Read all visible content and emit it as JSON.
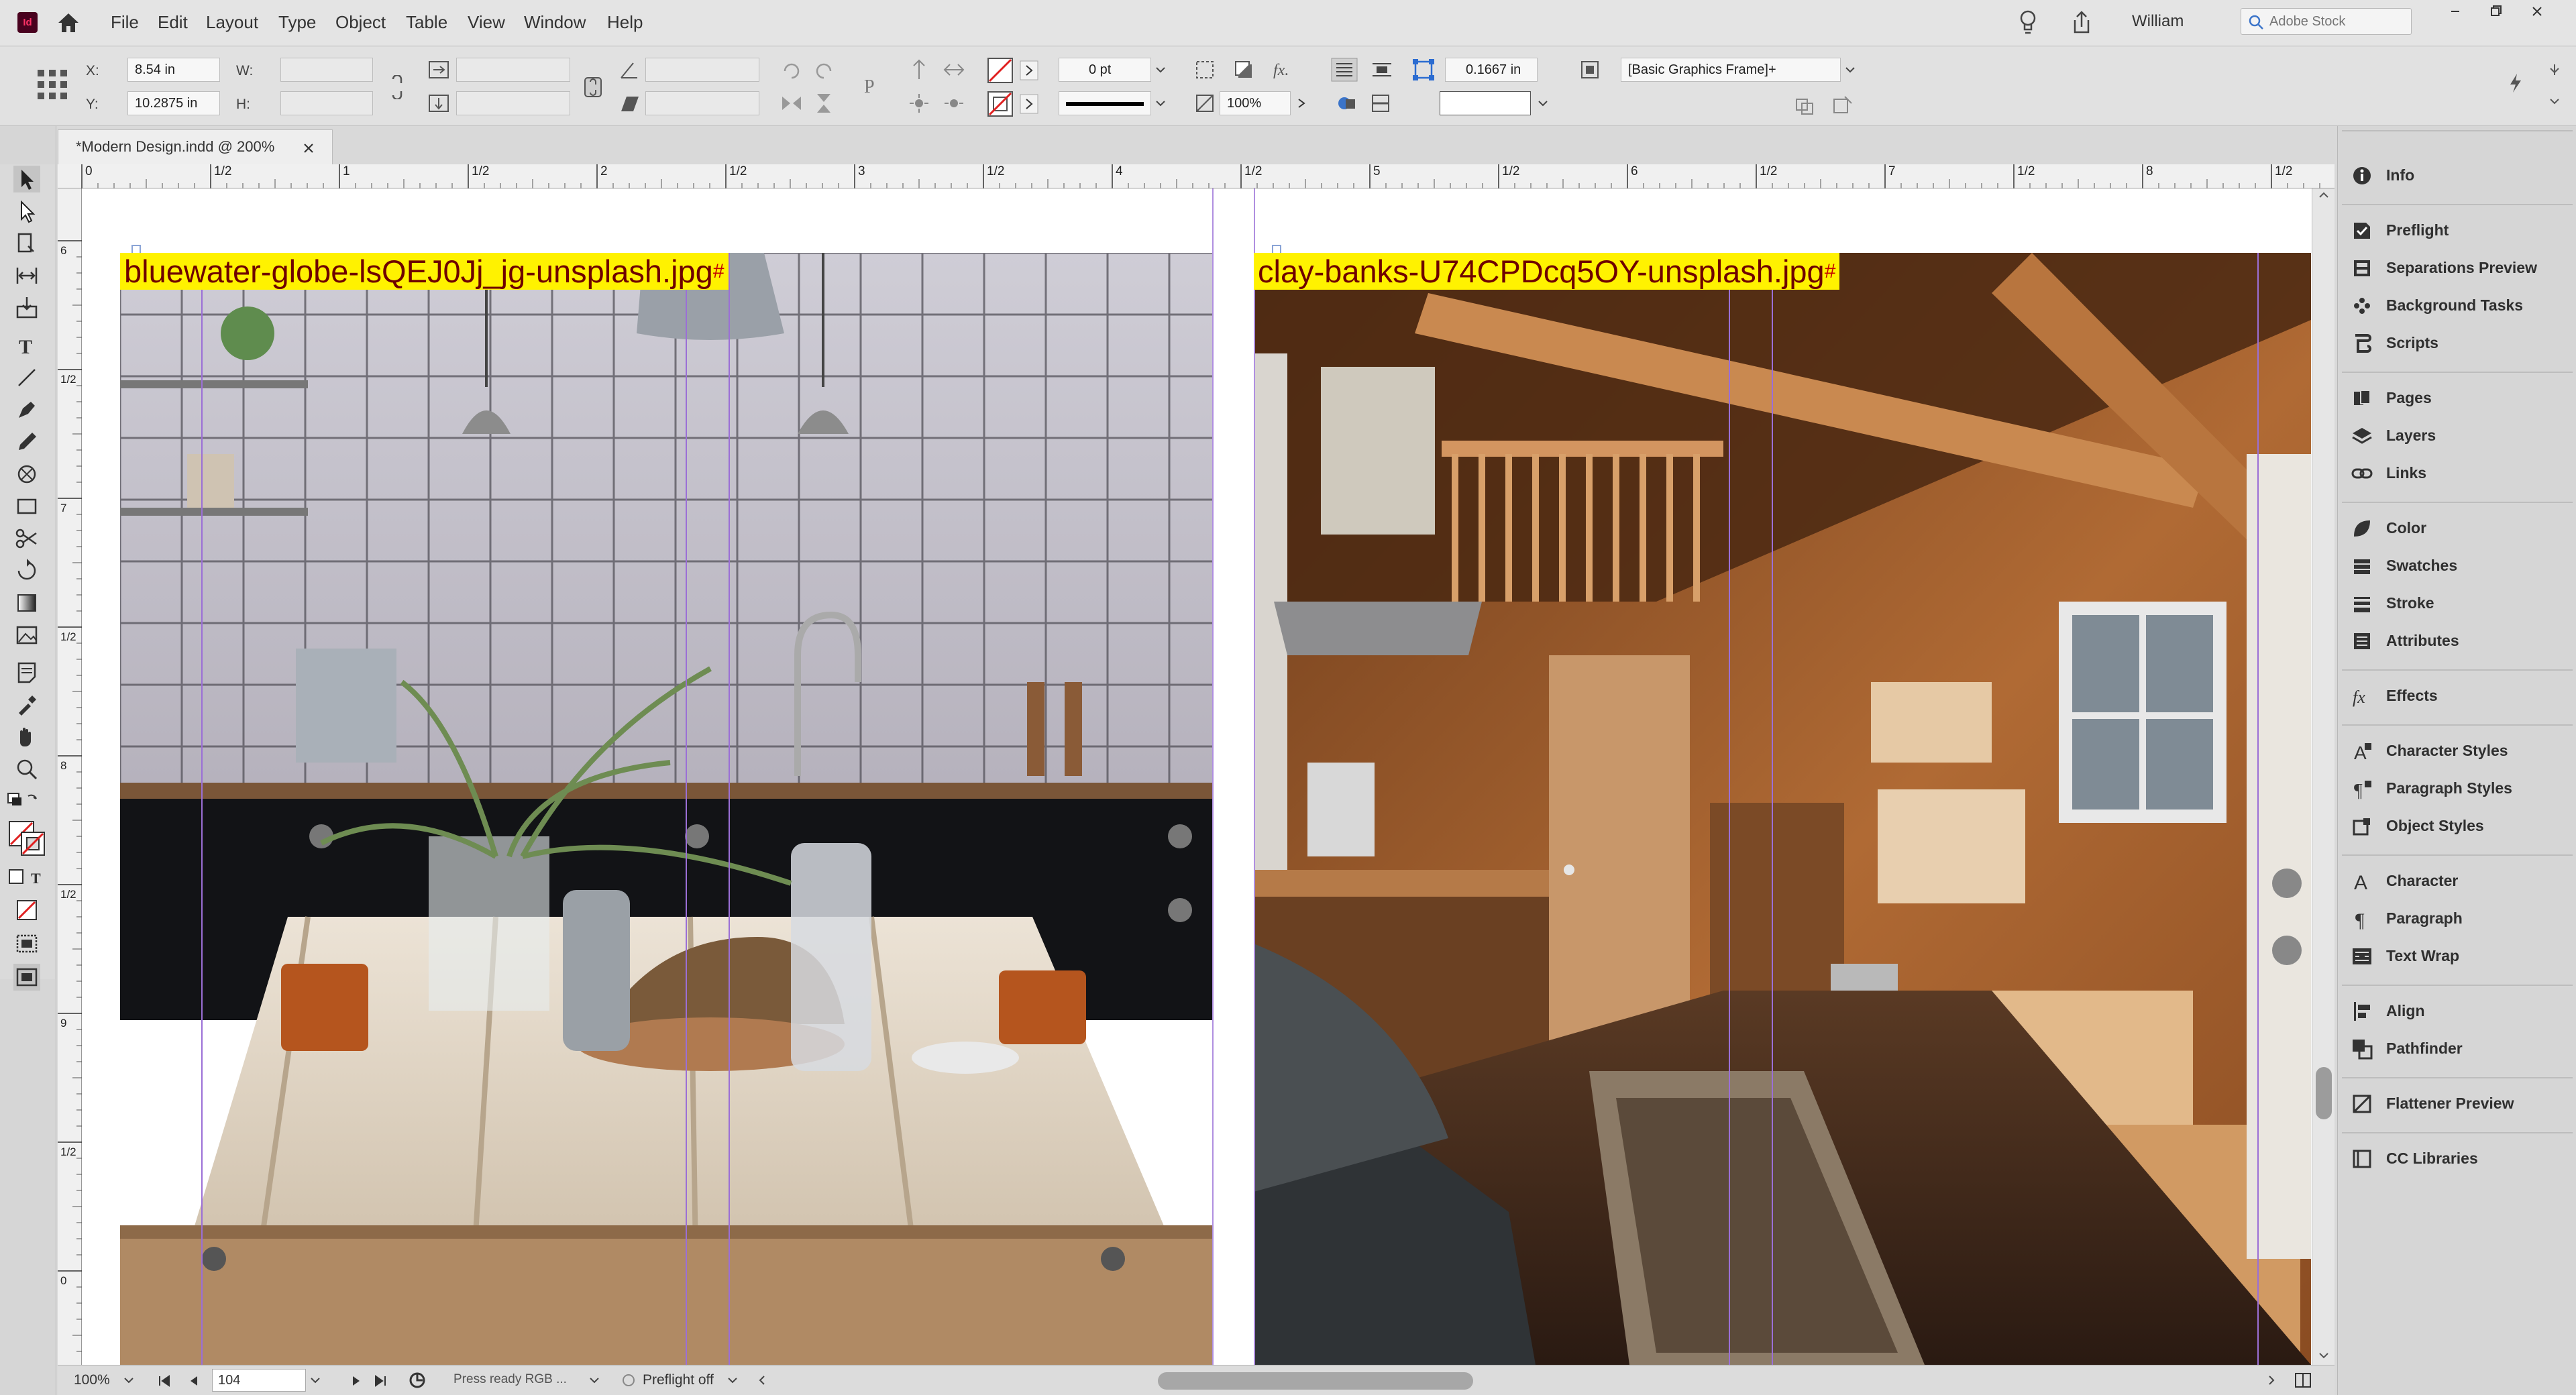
{
  "app": {
    "logo_text": "Id"
  },
  "menu": [
    "File",
    "Edit",
    "Layout",
    "Type",
    "Object",
    "Table",
    "View",
    "Window",
    "Help"
  ],
  "user": {
    "name": "William"
  },
  "stock_search": {
    "placeholder": "Adobe Stock"
  },
  "control": {
    "x_label": "X:",
    "x_value": "8.54 in",
    "y_label": "Y:",
    "y_value": "10.2875 in",
    "w_label": "W:",
    "w_value": "",
    "h_label": "H:",
    "h_value": "",
    "stroke_weight": "0 pt",
    "opacity": "100%",
    "offset_value": "0.1667 in",
    "object_style": "[Basic Graphics Frame]+"
  },
  "document": {
    "tab_title": "*Modern Design.indd @ 200%"
  },
  "ruler": {
    "h_labels": [
      "0",
      "1/2",
      "1",
      "1/2",
      "2",
      "1/2",
      "3",
      "1/2",
      "4",
      "1/2",
      "5",
      "1/2",
      "6",
      "1/2",
      "7",
      "1/2",
      "8",
      "1/2"
    ],
    "v_labels": [
      "6",
      "1/2",
      "7",
      "1/2",
      "8",
      "1/2",
      "9",
      "1/2",
      "0"
    ]
  },
  "frames": [
    {
      "label": "bluewater-globe-lsQEJ0Jj_jg-unsplash.jpg",
      "marker": "#"
    },
    {
      "label": "clay-banks-U74CPDcq5OY-unsplash.jpg",
      "marker": "#"
    }
  ],
  "panels": [
    {
      "label": "Info",
      "icon": "info-icon"
    },
    {
      "label": "Preflight",
      "icon": "preflight-icon"
    },
    {
      "label": "Separations Preview",
      "icon": "separations-icon"
    },
    {
      "label": "Background Tasks",
      "icon": "background-tasks-icon"
    },
    {
      "label": "Scripts",
      "icon": "scripts-icon"
    },
    {
      "label": "Pages",
      "icon": "pages-icon"
    },
    {
      "label": "Layers",
      "icon": "layers-icon"
    },
    {
      "label": "Links",
      "icon": "links-icon"
    },
    {
      "label": "Color",
      "icon": "color-icon"
    },
    {
      "label": "Swatches",
      "icon": "swatches-icon"
    },
    {
      "label": "Stroke",
      "icon": "stroke-icon"
    },
    {
      "label": "Attributes",
      "icon": "attributes-icon"
    },
    {
      "label": "Effects",
      "icon": "effects-icon"
    },
    {
      "label": "Character Styles",
      "icon": "character-styles-icon"
    },
    {
      "label": "Paragraph Styles",
      "icon": "paragraph-styles-icon"
    },
    {
      "label": "Object Styles",
      "icon": "object-styles-icon"
    },
    {
      "label": "Character",
      "icon": "character-icon"
    },
    {
      "label": "Paragraph",
      "icon": "paragraph-icon"
    },
    {
      "label": "Text Wrap",
      "icon": "text-wrap-icon"
    },
    {
      "label": "Align",
      "icon": "align-icon"
    },
    {
      "label": "Pathfinder",
      "icon": "pathfinder-icon"
    },
    {
      "label": "Flattener Preview",
      "icon": "flattener-icon"
    },
    {
      "label": "CC Libraries",
      "icon": "cc-libraries-icon"
    }
  ],
  "status": {
    "zoom": "100%",
    "page": "104",
    "ready_text": "Press ready RGB ...",
    "preflight": "Preflight off"
  },
  "colors": {
    "frame_label_bg": "#fff200",
    "frame_label_text": "#6e0000",
    "guide": "#9b59d0",
    "app_accent": "#49021f"
  }
}
